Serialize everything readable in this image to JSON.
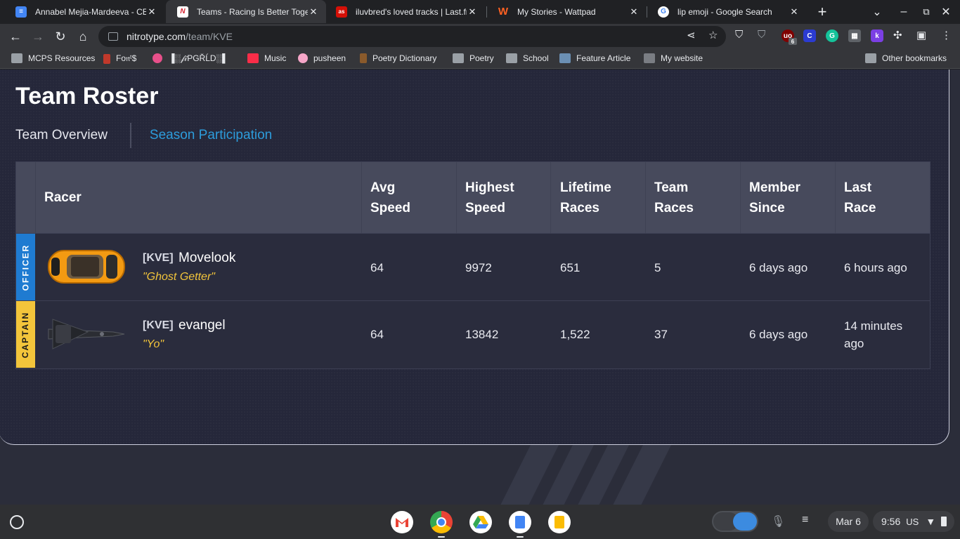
{
  "browser": {
    "tabs": [
      {
        "title": "Annabel Mejia-Mardeeva - CES",
        "favicon": "google-docs-icon",
        "color": "#4285f4"
      },
      {
        "title": "Teams - Racing Is Better Togeth",
        "favicon": "nitrotype-icon",
        "color": "#d6202f"
      },
      {
        "title": "iluvbred's loved tracks | Last.fm",
        "favicon": "lastfm-icon",
        "color": "#d51007"
      },
      {
        "title": "My Stories - Wattpad",
        "favicon": "wattpad-icon",
        "color": "#ff6122"
      },
      {
        "title": "lip emoji - Google Search",
        "favicon": "google-icon",
        "color": "#ffffff"
      }
    ],
    "url": {
      "host": "nitrotype.com",
      "path": "/team/KVE"
    },
    "extension_badge": "6",
    "bookmarks": [
      {
        "label": "MCPS Resources",
        "icon": "classroom-icon"
      },
      {
        "label": "Fo𝔫ᵗ$",
        "icon": "bottle-icon"
      },
      {
        "label": "",
        "icon": "picsart-icon"
      },
      {
        "label": "▐░𝒻𝒾PGŘĹD░▌",
        "icon": "doc-icon"
      },
      {
        "label": "Music",
        "icon": "music-icon"
      },
      {
        "label": "pusheen",
        "icon": "donut-icon"
      },
      {
        "label": "Poetry Dictionary",
        "icon": "deer-icon"
      },
      {
        "label": "Poetry",
        "icon": "folder-icon"
      },
      {
        "label": "School",
        "icon": "folder-icon"
      },
      {
        "label": "Feature Article",
        "icon": "article-icon"
      },
      {
        "label": "My website",
        "icon": "cube-icon"
      }
    ],
    "other_bookmarks": "Other bookmarks"
  },
  "page": {
    "title": "Team Roster",
    "tabs": [
      "Team Overview",
      "Season Participation"
    ],
    "active_tab": "Season Participation",
    "columns": {
      "racer": "Racer",
      "avg_speed": [
        "Avg",
        "Speed"
      ],
      "highest_speed": [
        "Highest",
        "Speed"
      ],
      "lifetime_races": [
        "Lifetime",
        "Races"
      ],
      "team_races": [
        "Team",
        "Races"
      ],
      "member_since": [
        "Member",
        "Since"
      ],
      "last_race": [
        "Last",
        "Race"
      ]
    },
    "rows": [
      {
        "role": "OFFICER",
        "tag": "[KVE]",
        "name": "Movelook",
        "motto": "\"Ghost Getter\"",
        "avg_speed": "64",
        "highest_speed": "9972",
        "lifetime_races": "651",
        "team_races": "5",
        "member_since": "6 days ago",
        "last_race": [
          "6 hours ago"
        ],
        "car": "orange-sports-car-icon"
      },
      {
        "role": "CAPTAIN",
        "tag": "[KVE]",
        "name": "evangel",
        "motto": "\"Yo\"",
        "avg_speed": "64",
        "highest_speed": "13842",
        "lifetime_races": "1,522",
        "team_races": "37",
        "member_since": "6 days ago",
        "last_race": [
          "14 minutes",
          "ago"
        ],
        "car": "stealth-jet-icon"
      }
    ]
  },
  "shelf": {
    "apps": [
      "gmail-icon",
      "chrome-icon",
      "drive-icon",
      "docs-icon",
      "slides-icon"
    ],
    "date": "Mar 6",
    "time": "9:56",
    "locale": "US"
  },
  "colors": {
    "accent_blue": "#2d9cdb",
    "officer": "#1f7bd1",
    "captain": "#f3c53b"
  }
}
